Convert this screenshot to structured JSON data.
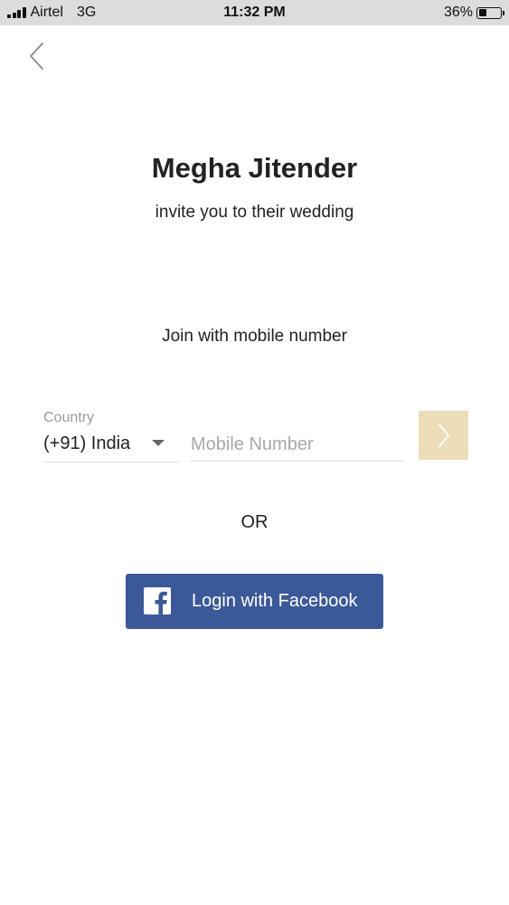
{
  "status_bar": {
    "carrier": "Airtel",
    "network": "3G",
    "time": "11:32 PM",
    "battery_text": "36%",
    "battery_level": 0.36
  },
  "navigation": {
    "back_icon": "chevron-left-icon"
  },
  "invite": {
    "host_name": "Megha Jitender",
    "message": "invite you to their wedding"
  },
  "join": {
    "heading": "Join with mobile number",
    "country_label": "Country",
    "country_value": "(+91) India",
    "mobile_placeholder": "Mobile Number",
    "mobile_value": "",
    "next_icon": "chevron-right-icon"
  },
  "separator": {
    "text": "OR"
  },
  "facebook": {
    "label": "Login with Facebook",
    "icon": "facebook-icon",
    "color": "#3b5998"
  },
  "colors": {
    "next_button": "#ecdcb8",
    "status_bar": "#dcdcdc"
  }
}
